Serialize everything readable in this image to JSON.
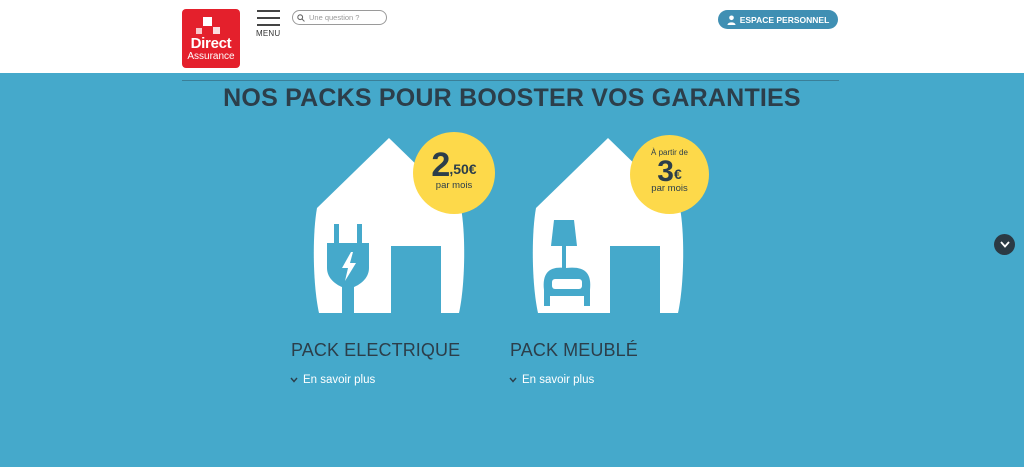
{
  "header": {
    "logo": {
      "line1": "Direct",
      "line2": "Assurance"
    },
    "menu_label": "MENU",
    "search": {
      "placeholder": "Une question ?",
      "value": ""
    },
    "espace_label": "ESPACE PERSONNEL"
  },
  "main": {
    "title": "NOS PACKS POUR BOOSTER VOS GARANTIES",
    "packs": [
      {
        "name": "PACK ELECTRIQUE",
        "price_main": "2",
        "price_sup": ",50€",
        "per_month": "par mois",
        "more_label": "En savoir plus",
        "icon": "plug-icon"
      },
      {
        "name": "PACK MEUBLÉ",
        "from_label": "À partir de",
        "price_main": "3",
        "price_sup": "€",
        "per_month": "par mois",
        "more_label": "En savoir plus",
        "icon": "armchair-lamp-icon"
      }
    ]
  },
  "colors": {
    "background": "#45a9cb",
    "badge": "#fdd94a",
    "brand_red": "#e4202c",
    "button_blue": "#3f8fb3",
    "text_dark": "#2c3e4a"
  }
}
